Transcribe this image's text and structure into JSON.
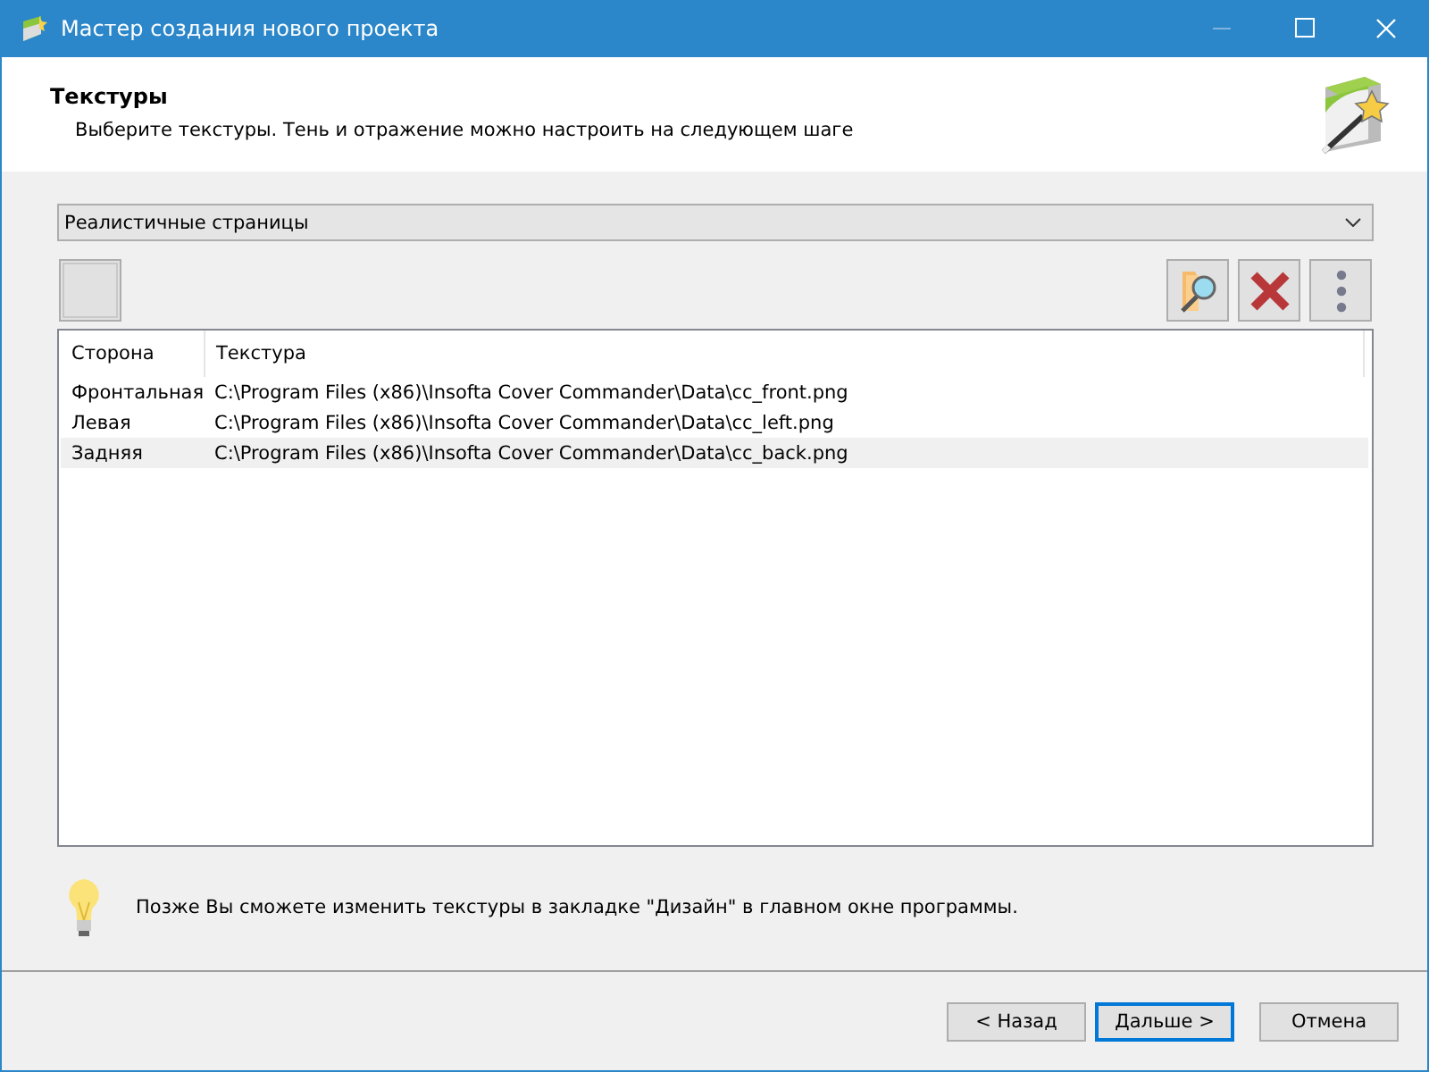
{
  "window": {
    "title": "Мастер создания нового проекта"
  },
  "header": {
    "title": "Текстуры",
    "subtitle": "Выберите текстуры. Тень и отражение можно настроить на следующем шаге"
  },
  "preset_dropdown": {
    "value": "Реалистичные страницы"
  },
  "table": {
    "columns": [
      "Сторона",
      "Текстура"
    ],
    "rows": [
      {
        "side": "Фронтальная",
        "texture": "C:\\Program Files (x86)\\Insofta Cover Commander\\Data\\cc_front.png",
        "selected": false
      },
      {
        "side": "Левая",
        "texture": "C:\\Program Files (x86)\\Insofta Cover Commander\\Data\\cc_left.png",
        "selected": false
      },
      {
        "side": "Задняя",
        "texture": "C:\\Program Files (x86)\\Insofta Cover Commander\\Data\\cc_back.png",
        "selected": true
      }
    ]
  },
  "hint": "Позже Вы сможете изменить текстуры в закладке \"Дизайн\" в главном окне программы.",
  "buttons": [
    {
      "label": "< Назад",
      "default": false
    },
    {
      "label": "Дальше >",
      "default": true
    },
    {
      "label": "Отмена",
      "default": false
    }
  ]
}
